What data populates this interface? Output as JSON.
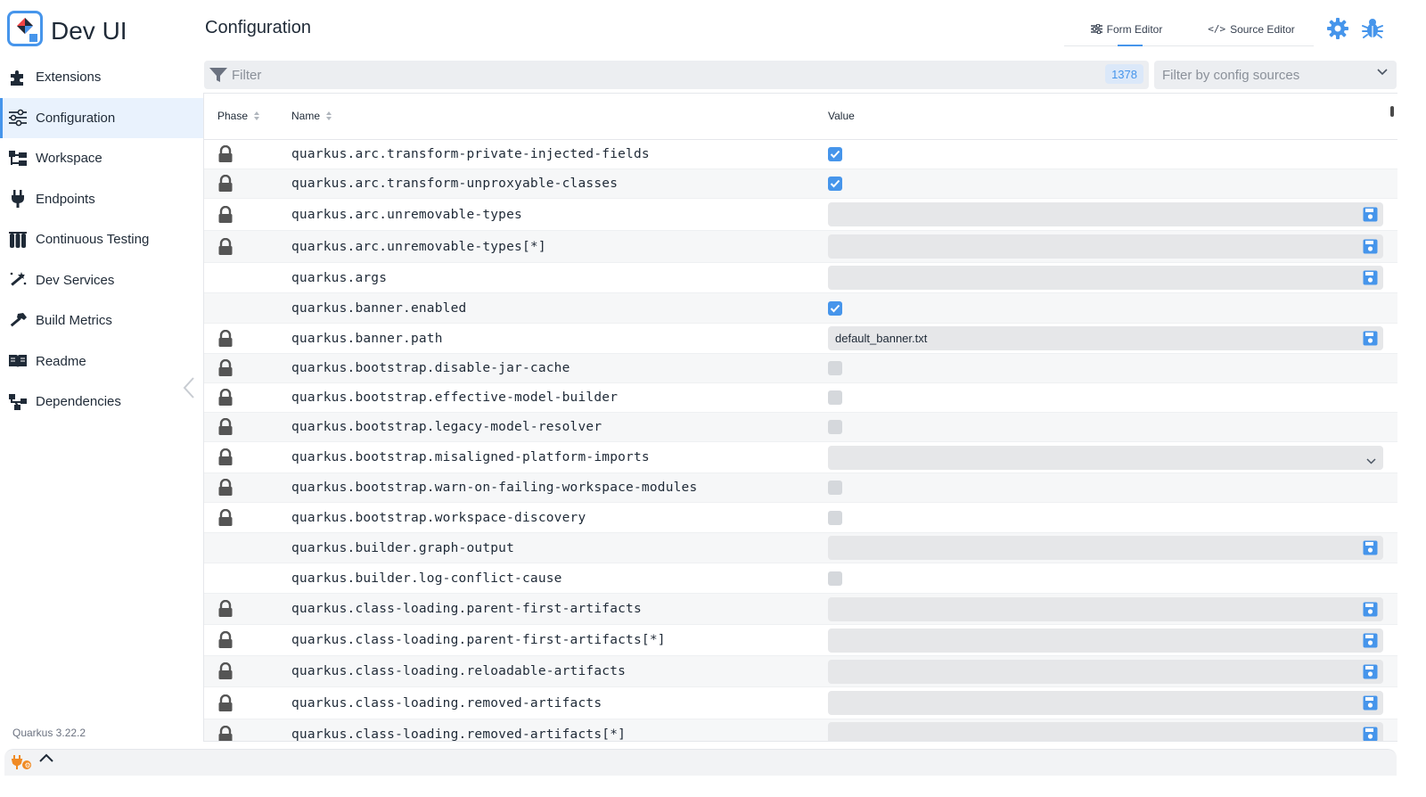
{
  "app": {
    "title": "Dev UI",
    "version": "Quarkus 3.22.2"
  },
  "sidebar": {
    "items": [
      {
        "label": "Extensions",
        "icon": "puzzle-icon"
      },
      {
        "label": "Configuration",
        "icon": "sliders-icon",
        "active": true
      },
      {
        "label": "Workspace",
        "icon": "folder-tree-icon"
      },
      {
        "label": "Endpoints",
        "icon": "plug-icon"
      },
      {
        "label": "Continuous Testing",
        "icon": "flask-icon"
      },
      {
        "label": "Dev Services",
        "icon": "magic-wand-icon"
      },
      {
        "label": "Build Metrics",
        "icon": "hammer-icon"
      },
      {
        "label": "Readme",
        "icon": "book-icon"
      },
      {
        "label": "Dependencies",
        "icon": "diagram-icon"
      }
    ]
  },
  "header": {
    "title": "Configuration",
    "tabs": [
      {
        "label": "Form Editor",
        "icon": "sliders-icon",
        "active": true
      },
      {
        "label": "Source Editor",
        "icon": "code-icon"
      }
    ],
    "theme_icon": "gear-icon",
    "debug_icon": "bug-icon"
  },
  "filter": {
    "placeholder": "Filter",
    "count": "1378",
    "source_placeholder": "Filter by config sources"
  },
  "grid": {
    "columns": {
      "phase": "Phase",
      "name": "Name",
      "value": "Value"
    },
    "rows": [
      {
        "name": "quarkus.arc.transform-private-injected-fields",
        "locked": true,
        "type": "checkbox",
        "checked": true
      },
      {
        "name": "quarkus.arc.transform-unproxyable-classes",
        "locked": true,
        "type": "checkbox",
        "checked": true
      },
      {
        "name": "quarkus.arc.unremovable-types",
        "locked": true,
        "type": "text",
        "value": ""
      },
      {
        "name": "quarkus.arc.unremovable-types[*]",
        "locked": true,
        "type": "text",
        "value": ""
      },
      {
        "name": "quarkus.args",
        "locked": false,
        "type": "text",
        "value": ""
      },
      {
        "name": "quarkus.banner.enabled",
        "locked": false,
        "type": "checkbox",
        "checked": true
      },
      {
        "name": "quarkus.banner.path",
        "locked": true,
        "type": "text",
        "value": "default_banner.txt"
      },
      {
        "name": "quarkus.bootstrap.disable-jar-cache",
        "locked": true,
        "type": "checkbox",
        "checked": false
      },
      {
        "name": "quarkus.bootstrap.effective-model-builder",
        "locked": true,
        "type": "checkbox",
        "checked": false
      },
      {
        "name": "quarkus.bootstrap.legacy-model-resolver",
        "locked": true,
        "type": "checkbox",
        "checked": false
      },
      {
        "name": "quarkus.bootstrap.misaligned-platform-imports",
        "locked": true,
        "type": "select",
        "value": ""
      },
      {
        "name": "quarkus.bootstrap.warn-on-failing-workspace-modules",
        "locked": true,
        "type": "checkbox",
        "checked": false
      },
      {
        "name": "quarkus.bootstrap.workspace-discovery",
        "locked": true,
        "type": "checkbox",
        "checked": false
      },
      {
        "name": "quarkus.builder.graph-output",
        "locked": false,
        "type": "text",
        "value": ""
      },
      {
        "name": "quarkus.builder.log-conflict-cause",
        "locked": false,
        "type": "checkbox",
        "checked": false
      },
      {
        "name": "quarkus.class-loading.parent-first-artifacts",
        "locked": true,
        "type": "text",
        "value": ""
      },
      {
        "name": "quarkus.class-loading.parent-first-artifacts[*]",
        "locked": true,
        "type": "text",
        "value": ""
      },
      {
        "name": "quarkus.class-loading.reloadable-artifacts",
        "locked": true,
        "type": "text",
        "value": ""
      },
      {
        "name": "quarkus.class-loading.removed-artifacts",
        "locked": true,
        "type": "text",
        "value": ""
      },
      {
        "name": "quarkus.class-loading.removed-artifacts[*]",
        "locked": true,
        "type": "text",
        "value": ""
      }
    ]
  },
  "footer": {
    "icon": "plugin-status-icon",
    "toggle_icon": "chevron-up-icon"
  },
  "colors": {
    "accent": "#4695eb",
    "active_bg": "#e9f2fd",
    "field_bg": "#e6e7e9",
    "lock": "#555555"
  }
}
